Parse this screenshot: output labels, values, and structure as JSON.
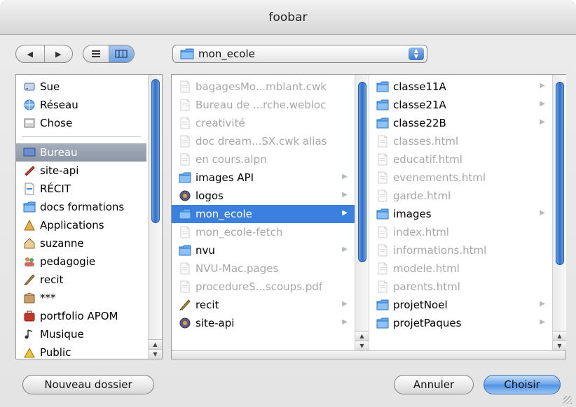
{
  "window": {
    "title": "foobar"
  },
  "toolbar": {
    "back_label": "◀",
    "forward_label": "▶",
    "path_value": "mon_ecole"
  },
  "sidebar": {
    "devices": [
      {
        "label": "Sue",
        "icon": "drive-icon"
      },
      {
        "label": "Réseau",
        "icon": "network-icon"
      },
      {
        "label": "Chose",
        "icon": "disk-icon"
      }
    ],
    "places": [
      {
        "label": "Bureau",
        "icon": "desktop-icon",
        "selected": true
      },
      {
        "label": "site-api",
        "icon": "app-icon"
      },
      {
        "label": "RÉCIT",
        "icon": "document-icon"
      },
      {
        "label": "docs formations",
        "icon": "folder-icon"
      },
      {
        "label": "Applications",
        "icon": "applications-icon"
      },
      {
        "label": "suzanne",
        "icon": "home-icon"
      },
      {
        "label": "pedagogie",
        "icon": "users-icon"
      },
      {
        "label": "recit",
        "icon": "quill-icon"
      },
      {
        "label": "***",
        "icon": "box-icon"
      },
      {
        "label": "portfolio APOM",
        "icon": "portfolio-icon"
      },
      {
        "label": "Musique",
        "icon": "music-icon"
      },
      {
        "label": "Public",
        "icon": "public-icon"
      }
    ]
  },
  "column1": [
    {
      "label": "bagagesMo...mblant.cwk",
      "enabled": false,
      "kind": "doc"
    },
    {
      "label": "Bureau de ...rche.webloc",
      "enabled": false,
      "kind": "doc"
    },
    {
      "label": "creativité",
      "enabled": false,
      "kind": "doc"
    },
    {
      "label": "doc dream...SX.cwk alias",
      "enabled": false,
      "kind": "doc"
    },
    {
      "label": "en cours.alpn",
      "enabled": false,
      "kind": "doc"
    },
    {
      "label": "images API",
      "enabled": true,
      "kind": "folder",
      "chevron": true
    },
    {
      "label": "logos",
      "enabled": true,
      "kind": "app",
      "chevron": true
    },
    {
      "label": "mon_ecole",
      "enabled": true,
      "kind": "folder",
      "chevron": true,
      "selected": true
    },
    {
      "label": "mon_ecole-fetch",
      "enabled": false,
      "kind": "doc"
    },
    {
      "label": "nvu",
      "enabled": true,
      "kind": "folder",
      "chevron": true
    },
    {
      "label": "NVU-Mac.pages",
      "enabled": false,
      "kind": "doc"
    },
    {
      "label": "procedureS...scoups.pdf",
      "enabled": false,
      "kind": "doc"
    },
    {
      "label": "recit",
      "enabled": true,
      "kind": "quill",
      "chevron": true
    },
    {
      "label": "site-api",
      "enabled": true,
      "kind": "app",
      "chevron": true
    }
  ],
  "column2": [
    {
      "label": "classe11A",
      "enabled": true,
      "kind": "folder",
      "chevron": true
    },
    {
      "label": "classe21A",
      "enabled": true,
      "kind": "folder",
      "chevron": true
    },
    {
      "label": "classe22B",
      "enabled": true,
      "kind": "folder",
      "chevron": true
    },
    {
      "label": "classes.html",
      "enabled": false,
      "kind": "doc"
    },
    {
      "label": "educatif.html",
      "enabled": false,
      "kind": "doc"
    },
    {
      "label": "evenements.html",
      "enabled": false,
      "kind": "doc"
    },
    {
      "label": "garde.html",
      "enabled": false,
      "kind": "doc"
    },
    {
      "label": "images",
      "enabled": true,
      "kind": "folder",
      "chevron": true
    },
    {
      "label": "index.html",
      "enabled": false,
      "kind": "doc"
    },
    {
      "label": "informations.html",
      "enabled": false,
      "kind": "doc"
    },
    {
      "label": "modele.html",
      "enabled": false,
      "kind": "doc"
    },
    {
      "label": "parents.html",
      "enabled": false,
      "kind": "doc"
    },
    {
      "label": "projetNoel",
      "enabled": true,
      "kind": "folder",
      "chevron": true
    },
    {
      "label": "projetPaques",
      "enabled": true,
      "kind": "folder",
      "chevron": true
    }
  ],
  "buttons": {
    "new_folder": "Nouveau dossier",
    "cancel": "Annuler",
    "choose": "Choisir"
  },
  "colors": {
    "selection": "#3b80dd",
    "folder": "#5aa0e6",
    "disabled_text": "#a7a7a7"
  }
}
